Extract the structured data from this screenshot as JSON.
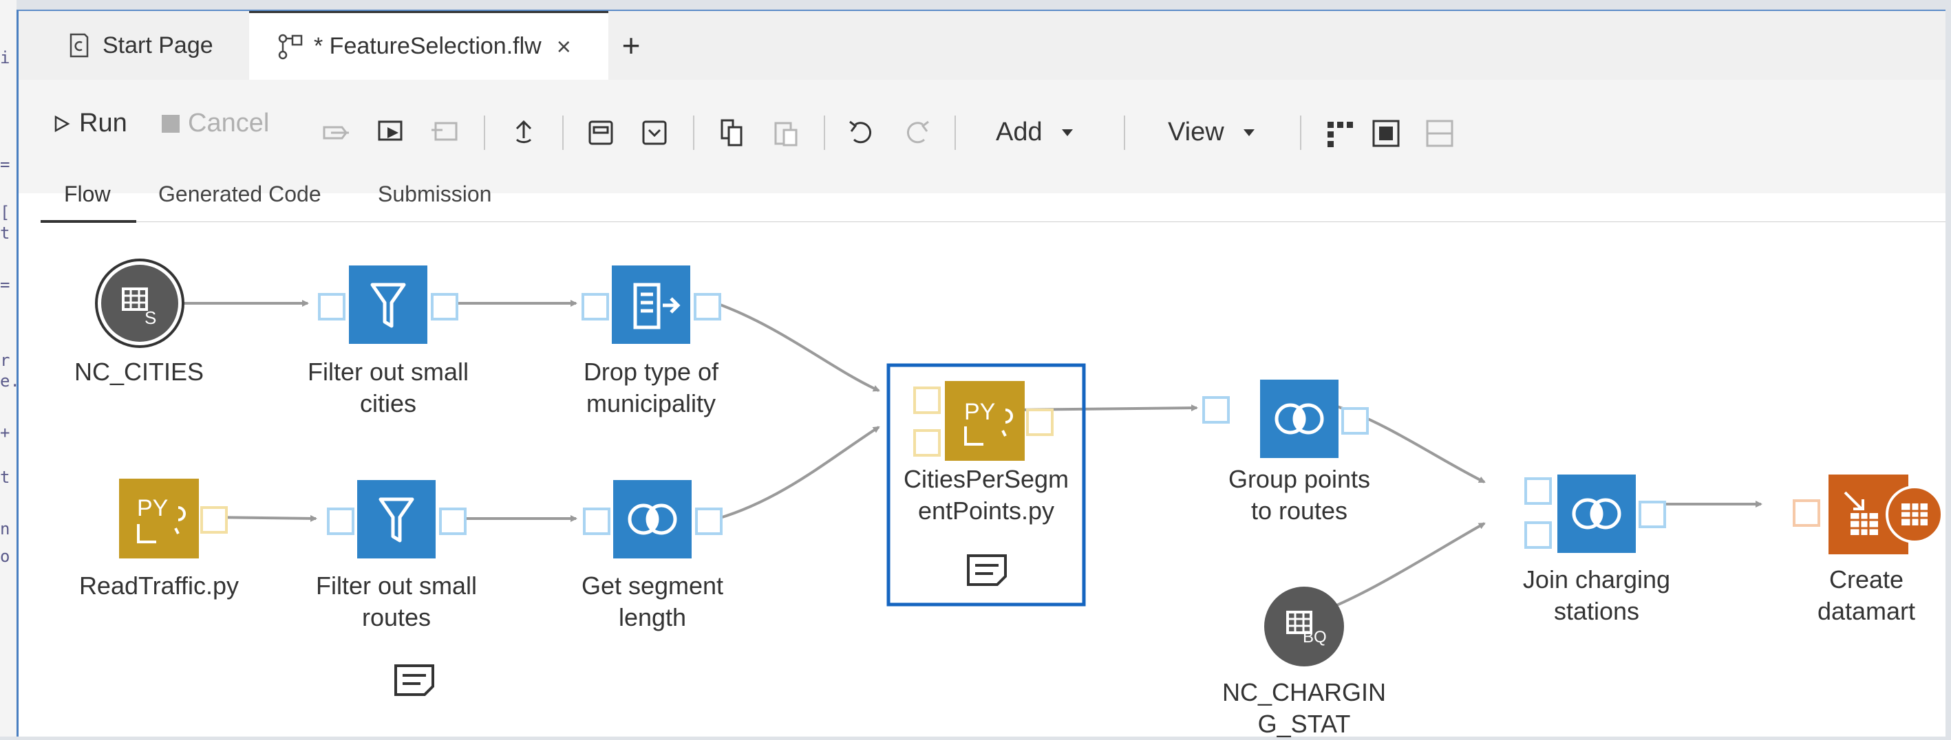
{
  "tabs": [
    {
      "label": "Start Page",
      "icon": "start-page-icon"
    },
    {
      "label": "* FeatureSelection.flw",
      "icon": "flow-file-icon",
      "close": "×"
    }
  ],
  "new_tab": "+",
  "toolbar": {
    "run": "Run",
    "cancel": "Cancel",
    "add": "Add",
    "view": "View"
  },
  "subtabs": [
    "Flow",
    "Generated Code",
    "Submission"
  ],
  "nodes": {
    "nc_cities": "NC_CITIES",
    "filter_cities": [
      "Filter out small",
      "cities"
    ],
    "drop_type": [
      "Drop type of",
      "municipality"
    ],
    "read_traffic": "ReadTraffic.py",
    "filter_routes": [
      "Filter out small",
      "routes"
    ],
    "segment_length": [
      "Get segment",
      "length"
    ],
    "cities_per_segment": [
      "CitiesPerSegm",
      "entPoints.py"
    ],
    "group_points": [
      "Group points",
      "to routes"
    ],
    "join_charging": [
      "Join charging",
      "stations"
    ],
    "nc_charging": [
      "NC_CHARGIN",
      "G_STAT"
    ],
    "create_datamart": [
      "Create",
      "datamart"
    ]
  },
  "node_badges": {
    "sas_table": "S",
    "bigquery_table": "BQ",
    "python": "PY"
  },
  "left_strip": [
    "i",
    "=",
    "[",
    "t",
    "=",
    "r",
    "e.",
    "+",
    "t",
    "n",
    "o"
  ],
  "colors": {
    "accent_blue": "#2e83c8",
    "python_gold": "#c49a22",
    "table_gray": "#595959",
    "output_orange": "#cc5f1a",
    "selection": "#1565c0"
  }
}
